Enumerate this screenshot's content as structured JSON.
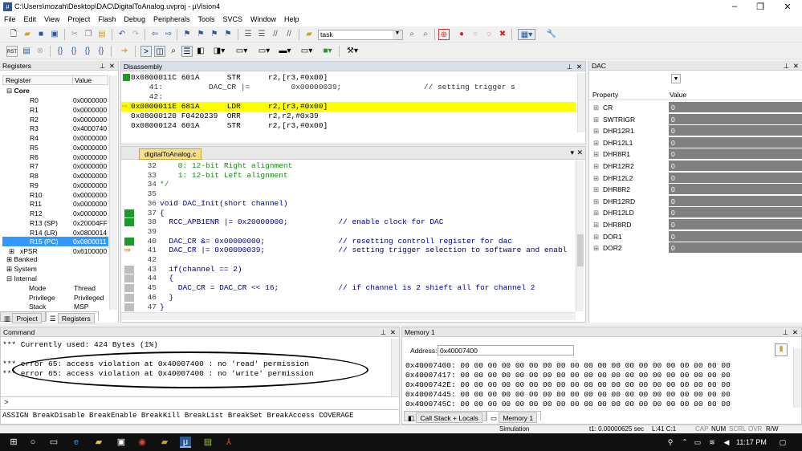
{
  "window": {
    "title": "C:\\Users\\mozah\\Desktop\\DAC\\DigitalToAnalog.uvproj - µVision4"
  },
  "menu": [
    "File",
    "Edit",
    "View",
    "Project",
    "Flash",
    "Debug",
    "Peripherals",
    "Tools",
    "SVCS",
    "Window",
    "Help"
  ],
  "toolbar": {
    "target": "task"
  },
  "registers": {
    "title": "Registers",
    "col_register": "Register",
    "col_value": "Value",
    "core_label": "Core",
    "rows": [
      {
        "name": "R0",
        "value": "0x0000000"
      },
      {
        "name": "R1",
        "value": "0x0000000"
      },
      {
        "name": "R2",
        "value": "0x0000000"
      },
      {
        "name": "R3",
        "value": "0x4000740"
      },
      {
        "name": "R4",
        "value": "0x0000000"
      },
      {
        "name": "R5",
        "value": "0x0000000"
      },
      {
        "name": "R6",
        "value": "0x0000000"
      },
      {
        "name": "R7",
        "value": "0x0000000"
      },
      {
        "name": "R8",
        "value": "0x0000000"
      },
      {
        "name": "R9",
        "value": "0x0000000"
      },
      {
        "name": "R10",
        "value": "0x0000000"
      },
      {
        "name": "R11",
        "value": "0x0000000"
      },
      {
        "name": "R12",
        "value": "0x0000000"
      },
      {
        "name": "R13 (SP)",
        "value": "0x20004FF"
      },
      {
        "name": "R14 (LR)",
        "value": "0x0800014"
      },
      {
        "name": "R15 (PC)",
        "value": "0x0800011"
      },
      {
        "name": "xPSR",
        "value": "0x6100000"
      }
    ],
    "groups": [
      "Banked",
      "System",
      "Internal"
    ],
    "internal": [
      {
        "name": "Mode",
        "value": "Thread"
      },
      {
        "name": "Privilege",
        "value": "Privileged"
      },
      {
        "name": "Stack",
        "value": "MSP"
      }
    ],
    "tabs": [
      "Project",
      "Registers"
    ]
  },
  "disassembly": {
    "title": "Disassembly",
    "lines": [
      "0x0800011C 601A      STR      r2,[r3,#0x00]",
      "    41:          DAC_CR |=         0x00000039;                  // setting trigger s",
      "    42:",
      "0x0800011E 681A      LDR      r2,[r3,#0x00]",
      "0x08000120 F0420239  ORR      r2,r2,#0x39",
      "0x08000124 601A      STR      r2,[r3,#0x00]"
    ]
  },
  "editor": {
    "tab": "digitalToAnalog.c",
    "lines": [
      {
        "n": "32",
        "t": "    0: 12-bit Right alignment"
      },
      {
        "n": "33",
        "t": "    1: 12-bit Left alignment"
      },
      {
        "n": "34",
        "t": "*/"
      },
      {
        "n": "35",
        "t": ""
      },
      {
        "n": "36",
        "t": "void DAC_Init(short channel)"
      },
      {
        "n": "37",
        "t": "{"
      },
      {
        "n": "38",
        "t": "  RCC_APB1ENR |= 0x20000000;           // enable clock for DAC"
      },
      {
        "n": "39",
        "t": ""
      },
      {
        "n": "40",
        "t": "  DAC_CR &= 0x00000000;                // resetting controll register for dac"
      },
      {
        "n": "41",
        "t": "  DAC_CR |= 0x00000039;                // setting trigger selection to software and enabl"
      },
      {
        "n": "42",
        "t": ""
      },
      {
        "n": "43",
        "t": "  if(channel == 2)"
      },
      {
        "n": "44",
        "t": "  {"
      },
      {
        "n": "45",
        "t": "    DAC_CR = DAC_CR << 16;             // if channel is 2 shieft all for channel 2"
      },
      {
        "n": "46",
        "t": "  }"
      },
      {
        "n": "47",
        "t": "}"
      }
    ]
  },
  "dac": {
    "title": "DAC",
    "col_property": "Property",
    "col_value": "Value",
    "rows": [
      {
        "name": "CR",
        "value": "0"
      },
      {
        "name": "SWTRIGR",
        "value": "0"
      },
      {
        "name": "DHR12R1",
        "value": "0"
      },
      {
        "name": "DHR12L1",
        "value": "0"
      },
      {
        "name": "DHR8R1",
        "value": "0"
      },
      {
        "name": "DHR12R2",
        "value": "0"
      },
      {
        "name": "DHR12L2",
        "value": "0"
      },
      {
        "name": "DHR8R2",
        "value": "0"
      },
      {
        "name": "DHR12RD",
        "value": "0"
      },
      {
        "name": "DHR12LD",
        "value": "0"
      },
      {
        "name": "DHR8RD",
        "value": "0"
      },
      {
        "name": "DOR1",
        "value": "0"
      },
      {
        "name": "DOR2",
        "value": "0"
      }
    ]
  },
  "command": {
    "title": "Command",
    "lines": [
      "*** Currently used: 424 Bytes (1%)",
      "",
      "*** error 65: access violation at 0x40007400 : no 'read' permission",
      "*** error 65: access violation at 0x40007400 : no 'write' permission"
    ],
    "prompt": ">",
    "hint": "ASSIGN BreakDisable BreakEnable BreakKill BreakList BreakSet BreakAccess COVERAGE"
  },
  "memory": {
    "title": "Memory 1",
    "address_label": "Address:",
    "address": "0x40007400",
    "rows": [
      "0x40007400: 00 00 00 00 00 00 00 00 00 00 00 00 00 00 00 00 00 00 00 00",
      "0x40007417: 00 00 00 00 00 00 00 00 00 00 00 00 00 00 00 00 00 00 00 00",
      "0x4000742E: 00 00 00 00 00 00 00 00 00 00 00 00 00 00 00 00 00 00 00 00",
      "0x40007445: 00 00 00 00 00 00 00 00 00 00 00 00 00 00 00 00 00 00 00 00",
      "0x4000745C: 00 00 00 00 00 00 00 00 00 00 00 00 00 00 00 00 00 00 00 00"
    ],
    "tabs": [
      "Call Stack + Locals",
      "Memory 1"
    ]
  },
  "status": {
    "mode": "Simulation",
    "time": "t1: 0.00000625 sec",
    "pos": "L:41 C:1",
    "cap": "CAP",
    "num": "NUM",
    "scrl": "SCRL",
    "ovr": "OVR",
    "rw": "R/W"
  },
  "taskbar": {
    "time": "11:17 PM"
  }
}
